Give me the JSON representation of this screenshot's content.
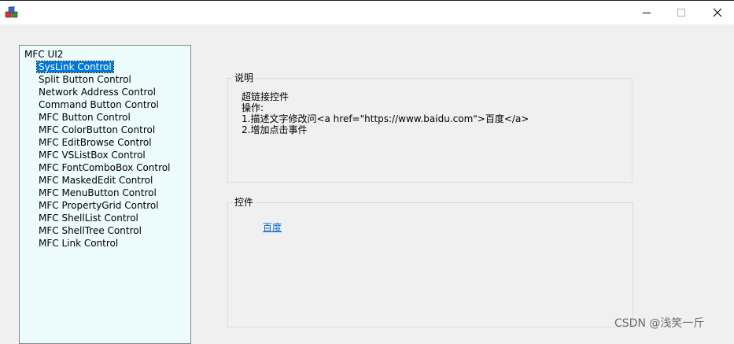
{
  "window": {
    "minimize_glyph": "—",
    "maximize_glyph": "☐",
    "close_glyph": "✕"
  },
  "tree": {
    "root": "MFC UI2",
    "selected_index": 0,
    "items": [
      "SysLink Control",
      "Split Button Control",
      "Network Address Control",
      "Command Button Control",
      "MFC Button Control",
      "MFC ColorButton Control",
      "MFC EditBrowse Control",
      "MFC VSListBox Control",
      "MFC FontComboBox Control",
      "MFC MaskedEdit Control",
      "MFC MenuButton Control",
      "MFC PropertyGrid Control",
      "MFC ShellList Control",
      "MFC ShellTree Control",
      "MFC Link Control"
    ]
  },
  "description_group": {
    "label": "说明",
    "lines": [
      "超链接控件",
      "操作:",
      "1.描述文字修改问<a href=\"https://www.baidu.com\">百度</a>",
      "2.增加点击事件"
    ]
  },
  "control_group": {
    "label": "控件",
    "link_text": "百度"
  },
  "watermark": "CSDN @浅笑一斤",
  "colors": {
    "selection": "#0078d7",
    "link": "#0066cc",
    "tree_background": "#ecfbfb"
  }
}
